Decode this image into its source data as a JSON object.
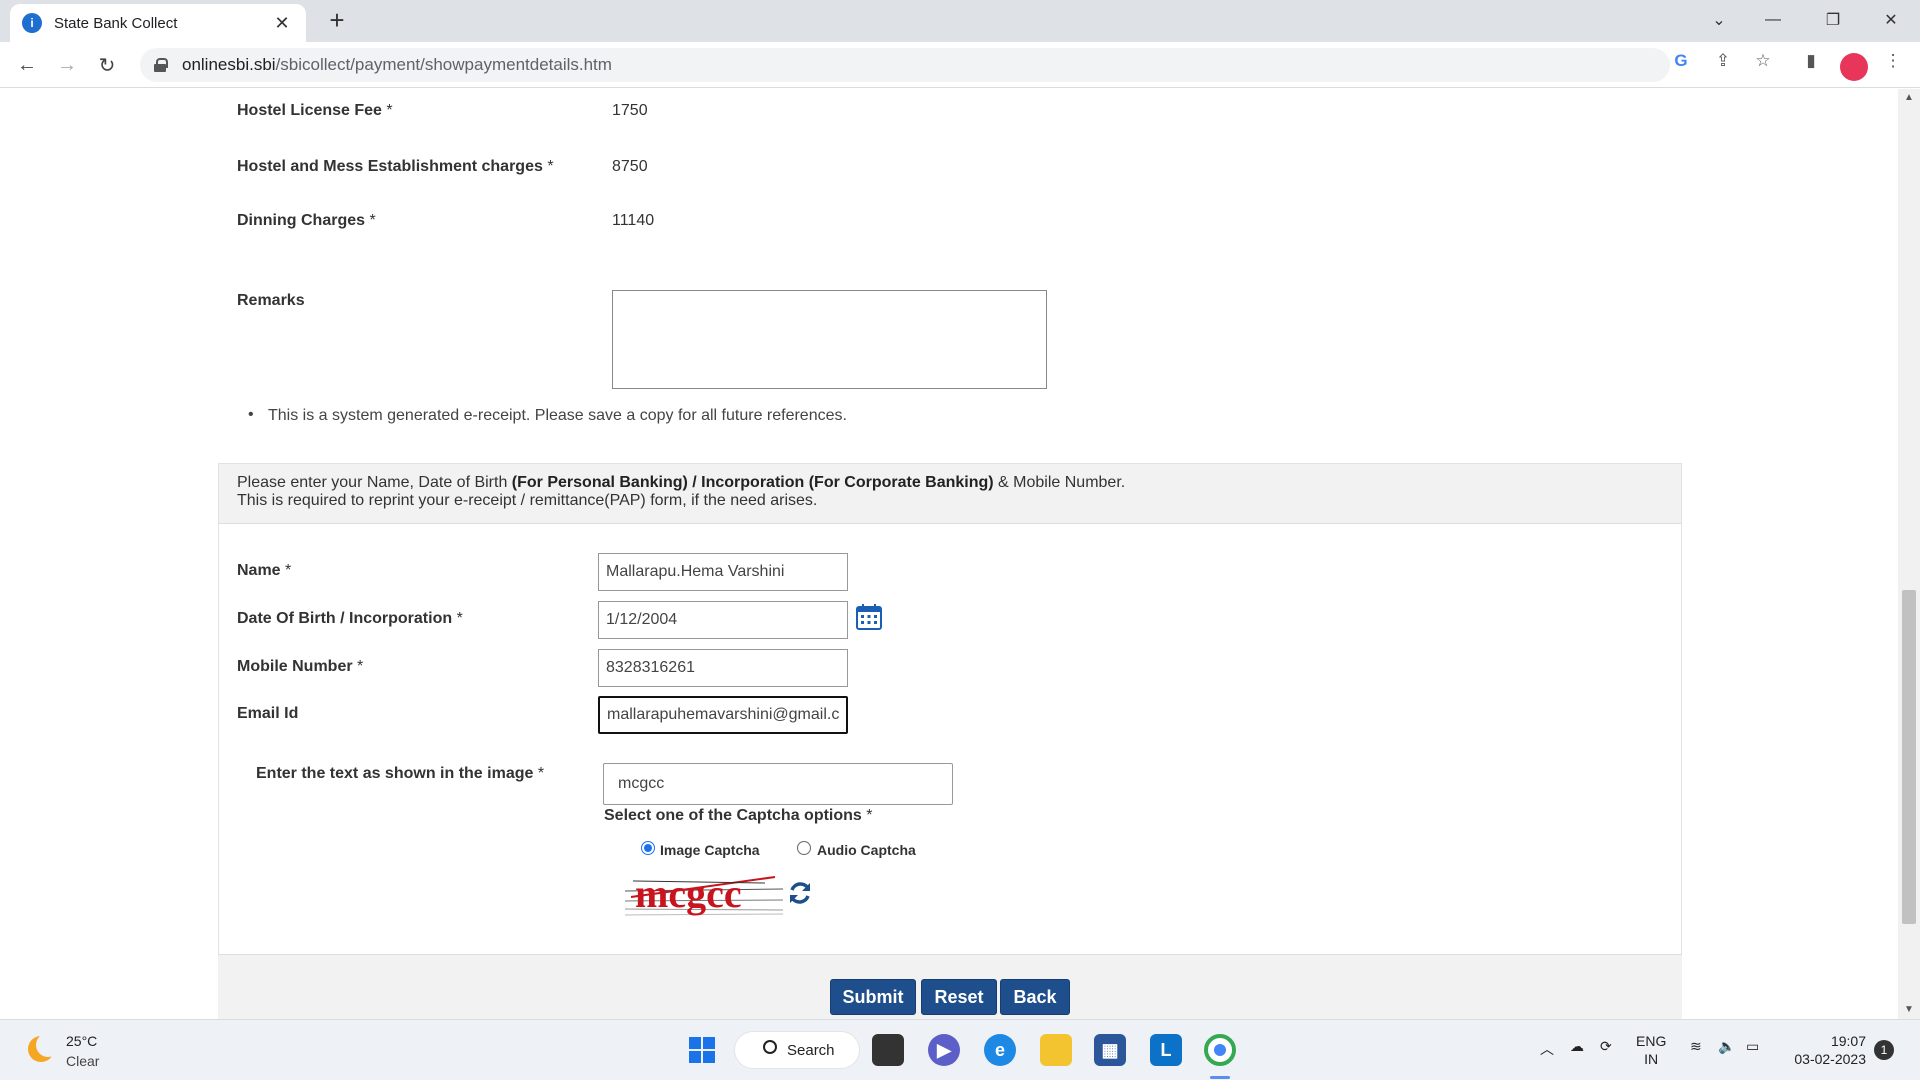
{
  "browser": {
    "tab_title": "State Bank Collect",
    "url_domain": "onlinesbi.sbi",
    "url_path": "/sbicollect/payment/showpaymentdetails.htm"
  },
  "fees": [
    {
      "label": "Hostel License Fee",
      "required": "*",
      "value": "1750"
    },
    {
      "label": "Hostel and Mess Establishment charges",
      "required": "*",
      "value": "8750"
    },
    {
      "label": "Dinning Charges",
      "required": "*",
      "value": "11140"
    }
  ],
  "remarks": {
    "label": "Remarks",
    "value": ""
  },
  "notice": "This is a system generated e-receipt. Please save a copy for all future references.",
  "info": {
    "line1_a": "Please enter your Name, Date of Birth ",
    "line1_bold": "(For Personal Banking) / Incorporation (For Corporate Banking)",
    "line1_b": " & Mobile Number.",
    "line2": "This is required to reprint your e-receipt / remittance(PAP) form, if the need arises."
  },
  "form": {
    "name": {
      "label": "Name",
      "required": "*",
      "value": "Mallarapu.Hema Varshini"
    },
    "dob": {
      "label": "Date Of Birth / Incorporation",
      "required": "*",
      "value": "1/12/2004"
    },
    "mobile": {
      "label": "Mobile Number",
      "required": "*",
      "value": "8328316261"
    },
    "email": {
      "label": "Email Id",
      "value": "mallarapuhemavarshini@gmail.c"
    }
  },
  "captcha": {
    "label": "Enter the text as shown in the image",
    "required": "*",
    "value": "mcgcc",
    "options_label": "Select one of the Captcha options",
    "options_required": "*",
    "option_image": "Image Captcha",
    "option_audio": "Audio Captcha",
    "selected": "Image Captcha",
    "image_text": "mcgcc"
  },
  "buttons": {
    "submit": "Submit",
    "reset": "Reset",
    "back": "Back"
  },
  "taskbar": {
    "temp": "25°C",
    "condition": "Clear",
    "search": "Search",
    "lang1": "ENG",
    "lang2": "IN",
    "time": "19:07",
    "date": "03-02-2023",
    "notifications": "1"
  },
  "colors": {
    "button": "#1f4e8c",
    "radio_selected": "#1a73e8",
    "captcha_text": "#c8141e"
  }
}
